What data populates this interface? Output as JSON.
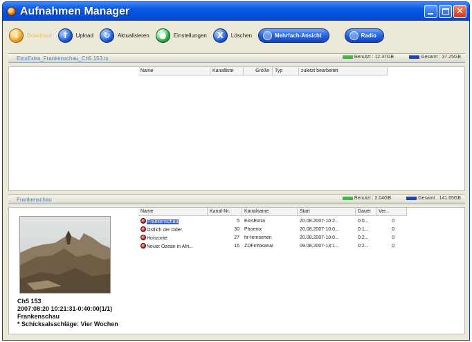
{
  "window": {
    "title": "Aufnahmen Manager"
  },
  "toolbar": {
    "download": "Download",
    "upload": "Upload",
    "refresh": "Aktualisieren",
    "settings": "Einstellungen",
    "delete": "Löschen",
    "multiview": "Mehrfach-Ansicht",
    "radio": "Radio"
  },
  "top_section": {
    "title": "EinsExtra_Frankenschau_Ch5 153.ts",
    "used_label": "Benutzt : 12.37GB",
    "total_label": "Gesamt : 37.25GB",
    "columns": [
      "Name",
      "Kanalliste",
      "Größe",
      "Typ",
      "zuletzt bearbeitet"
    ]
  },
  "bottom_section": {
    "title": "Frankenschau",
    "used_label": "Benutzt : 2.04GB",
    "total_label": "Gesamt : 141.65GB",
    "columns": [
      "Name",
      "Kanal-Nr.",
      "Kanalname",
      "Start",
      "Dauer",
      "Ver..."
    ],
    "rows": [
      {
        "name": "Frankenschau",
        "channel_no": "5",
        "channel_name": "EinsExtra",
        "start": "20.08.2007-10:2...",
        "duration": "0:0...",
        "version": "0"
      },
      {
        "name": "Östlich der Oder",
        "channel_no": "30",
        "channel_name": "Phoenix",
        "start": "20.08.2007-10:0...",
        "duration": "0:1...",
        "version": "0"
      },
      {
        "name": "Horizonte",
        "channel_no": "27",
        "channel_name": "hr-fernsehen",
        "start": "20.08.2007-10:0...",
        "duration": "0:2...",
        "version": "0"
      },
      {
        "name": "Neuer Ozean in Afri...",
        "channel_no": "16",
        "channel_name": "ZDFinfokanal",
        "start": "09.08.2007-13:1...",
        "duration": "0:2...",
        "version": "0"
      }
    ],
    "info": {
      "line1": "Ch5 153",
      "line2": "2007:08:20 10:21:31-0:40:00(1/1)",
      "line3": "Frankenschau",
      "line4": "* Schicksalsschläge: Vier Wochen"
    }
  },
  "colors": {
    "titlebar": "#0a5ae6",
    "used": "#46b34b",
    "total": "#2446a8",
    "selection": "#2f5fcf"
  }
}
